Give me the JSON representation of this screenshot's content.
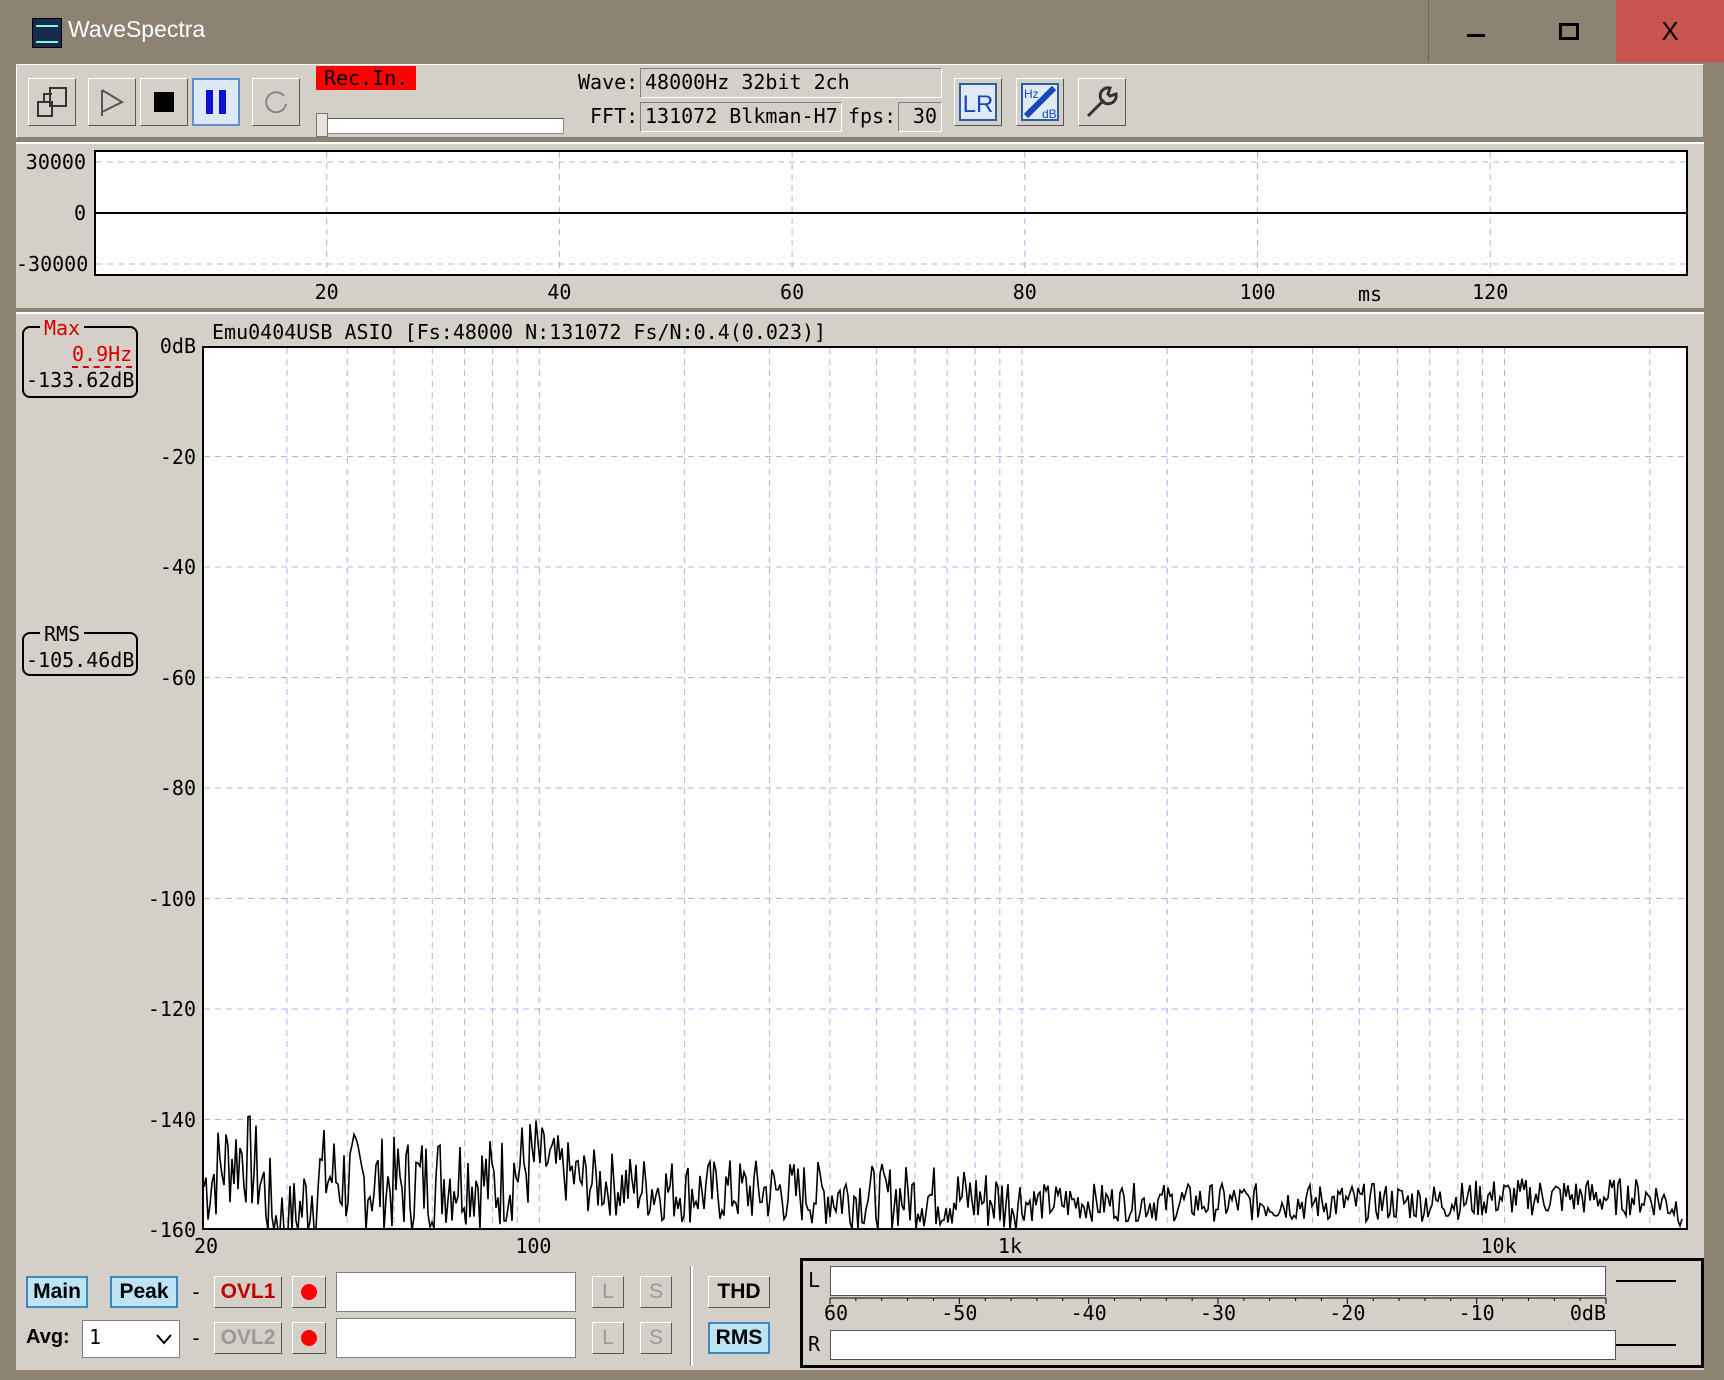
{
  "window": {
    "title": "WaveSpectra",
    "close_glyph": "X"
  },
  "toolbar": {
    "rec_label": "Rec.In.",
    "wave_label": "Wave:",
    "wave_value": "48000Hz 32bit 2ch",
    "fft_label": "FFT:",
    "fft_value": "131072 Blkman-H7",
    "fps_label": "fps:",
    "fps_value": "30",
    "icons": [
      "open-config-icon",
      "play-icon",
      "stop-icon",
      "pause-icon",
      "refresh-icon",
      "lr-channel-icon",
      "hz-db-scale-icon",
      "settings-wrench-icon"
    ],
    "lr_label": "LR",
    "hz_label": "Hz",
    "db_label": "dB"
  },
  "waveform": {
    "y_ticks": [
      "30000",
      "0",
      "-30000"
    ],
    "x_ticks": [
      "20",
      "40",
      "60",
      "80",
      "100",
      "120"
    ],
    "x_unit": "ms"
  },
  "spectrum": {
    "header": "Emu0404USB ASIO  [Fs:48000 N:131072 Fs/N:0.4(0.023)]",
    "max_label": "Max",
    "max_freq": "0.9Hz",
    "max_db": "-133.62dB",
    "rms_label": "RMS",
    "rms_db": "-105.46dB"
  },
  "chart_data": {
    "type": "line",
    "x_scale": "log",
    "xlim": [
      20,
      24000
    ],
    "ylim": [
      -160,
      0
    ],
    "x_tick_labels": [
      "20",
      "100",
      "1k",
      "10k"
    ],
    "y_tick_labels": [
      "0dB",
      "-20",
      "-40",
      "-60",
      "-80",
      "-100",
      "-120",
      "-140",
      "-160"
    ],
    "grid": true,
    "series": [
      {
        "x": [
          20,
          22,
          24,
          26,
          28,
          30,
          35,
          40,
          50,
          60,
          70,
          80,
          90,
          100,
          120,
          150,
          200,
          300,
          500,
          700,
          1000,
          2000,
          3000,
          5000,
          7000,
          10000,
          15000,
          20000,
          23000
        ],
        "y": [
          -152,
          -148,
          -146,
          -150,
          -158,
          -160,
          -150,
          -151,
          -152,
          -151,
          -150,
          -152,
          -149,
          -147,
          -151,
          -152,
          -153,
          -153,
          -154,
          -154,
          -155,
          -155,
          -155,
          -155,
          -155,
          -154,
          -154,
          -154,
          -156
        ]
      }
    ]
  },
  "bottom": {
    "main_label": "Main",
    "peak_label": "Peak",
    "dash": "-",
    "ovl1_label": "OVL1",
    "ovl2_label": "OVL2",
    "avg_label": "Avg:",
    "avg_value": "1",
    "l_label": "L",
    "s_label": "S",
    "thd_label": "THD",
    "rms_label": "RMS",
    "meter_l": "L",
    "meter_r": "R",
    "meter_ticks": [
      "-60",
      "-50",
      "-40",
      "-30",
      "-20",
      "-10",
      "0dB"
    ],
    "level_l": 0,
    "level_r": 0
  }
}
